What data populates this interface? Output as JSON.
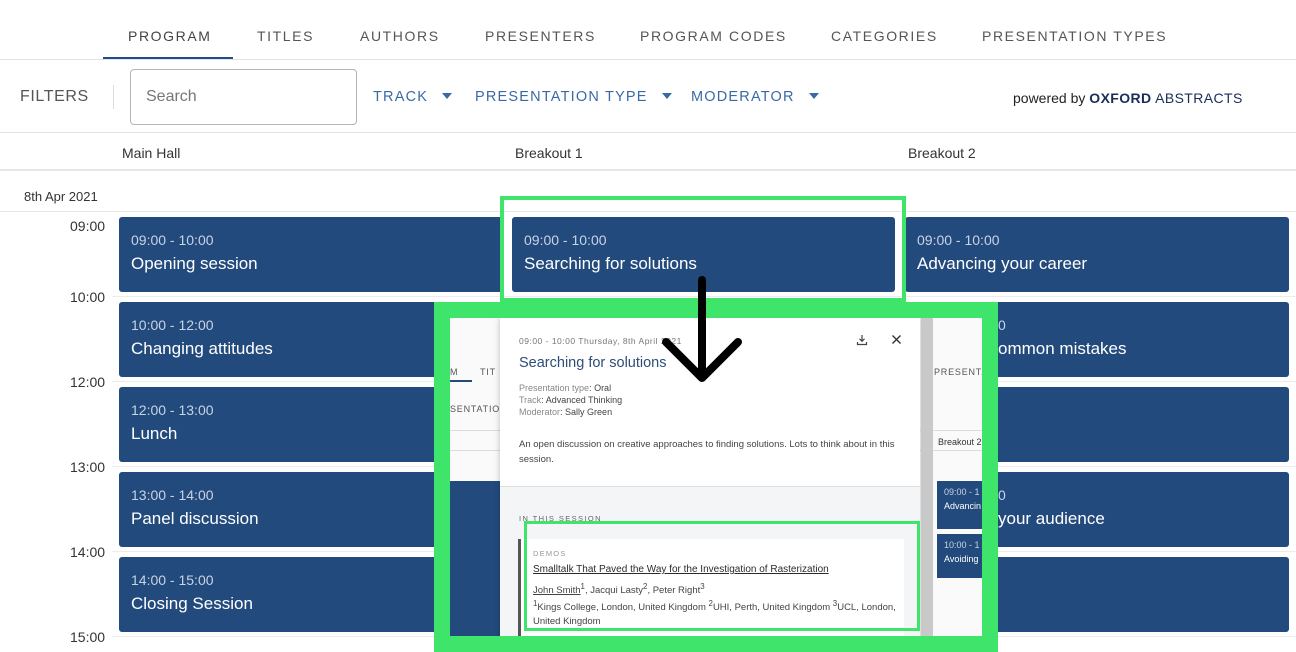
{
  "tabs": [
    {
      "label": "PROGRAM",
      "active": true
    },
    {
      "label": "TITLES"
    },
    {
      "label": "AUTHORS"
    },
    {
      "label": "PRESENTERS"
    },
    {
      "label": "PROGRAM CODES"
    },
    {
      "label": "CATEGORIES"
    },
    {
      "label": "PRESENTATION TYPES"
    }
  ],
  "filters": {
    "label": "FILTERS",
    "search_placeholder": "Search",
    "dropdowns": [
      "TRACK",
      "PRESENTATION TYPE",
      "MODERATOR"
    ],
    "powered_prefix": "powered by ",
    "brand_bold": "OXFORD",
    "brand_rest": " ABSTRACTS"
  },
  "rooms": [
    "Main Hall",
    "Breakout 1",
    "Breakout 2"
  ],
  "date": "8th Apr 2021",
  "times": [
    "09:00",
    "10:00",
    "12:00",
    "13:00",
    "14:00",
    "15:00"
  ],
  "sessions": {
    "main": [
      {
        "time": "09:00 - 10:00",
        "title": "Opening session"
      },
      {
        "time": "10:00 - 12:00",
        "title": "Changing attitudes"
      },
      {
        "time": "12:00 - 13:00",
        "title": "Lunch"
      },
      {
        "time": "13:00 - 14:00",
        "title": "Panel discussion"
      },
      {
        "time": "14:00 - 15:00",
        "title": "Closing Session"
      }
    ],
    "breakout1": [
      {
        "time": "09:00 - 10:00",
        "title": "Searching for solutions"
      }
    ],
    "breakout2": [
      {
        "time": "09:00 - 10:00",
        "title": "Advancing your career"
      },
      {
        "time": "0",
        "title": "ommon mistakes"
      },
      {
        "time": "0",
        "title": "your audience"
      }
    ]
  },
  "inner": {
    "bg_fragments": {
      "tab_m": "M",
      "tab_tit": "TIT",
      "tab_presentation": "PRESENTATION",
      "filter_sentation": "SENTATION",
      "breakout2": "Breakout 2",
      "b2_time1": "09:00 - 1",
      "b2_title1": "Advancin",
      "b2_time2": "10:00 - 1",
      "b2_title2": "Avoiding"
    },
    "modal": {
      "meta": "09:00 - 10:00 Thursday, 8th April 2021",
      "title": "Searching for solutions",
      "presentation_type_key": "Presentation type",
      "presentation_type": "Oral",
      "track_key": "Track",
      "track": "Advanced Thinking",
      "moderator_key": "Moderator",
      "moderator": "Sally Green",
      "description": "An open discussion on creative approaches to finding solutions. Lots to think about in this session.",
      "section_label": "IN THIS SESSION",
      "card": {
        "tag": "DEMOS",
        "title": "Smalltalk That Paved the Way for the Investigation of Rasterization",
        "author1": "John Smith",
        "author1_sup": "1",
        "author2": ", Jacqui Lasty",
        "author2_sup": "2",
        "author3": ", Peter Right",
        "author3_sup": "3",
        "aff1_sup": "1",
        "aff1": "Kings College, London, United Kingdom ",
        "aff2_sup": "2",
        "aff2": "UHI, Perth, United Kingdom ",
        "aff3_sup": "3",
        "aff3": "UCL, London, United Kingdom"
      }
    }
  },
  "colors": {
    "session_bg": "#234a7c",
    "accent": "#3a6aa6",
    "annotation_green": "#3fe56b"
  }
}
